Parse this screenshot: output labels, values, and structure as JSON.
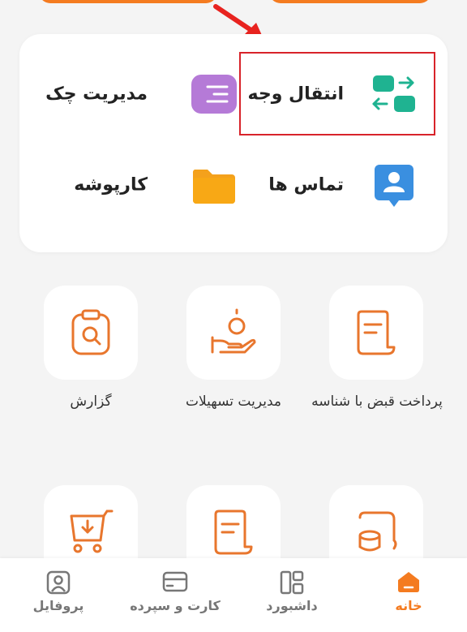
{
  "colors": {
    "accent": "#f47b20",
    "highlight": "#d8232a",
    "teal": "#1fb391",
    "purple": "#b57ad7",
    "blue": "#3a8fe0",
    "folder": "#f4a11c"
  },
  "quick_actions": [
    {
      "label": "انتقال وجه",
      "icon": "transfer-arrows-icon"
    },
    {
      "label": "مدیریت چک",
      "icon": "cheque-icon"
    },
    {
      "label": "تماس ها",
      "icon": "contacts-icon"
    },
    {
      "label": "کارپوشه",
      "icon": "folder-icon"
    }
  ],
  "services": [
    {
      "label": "پرداخت قبض با شناسه",
      "icon": "bill-icon"
    },
    {
      "label": "مدیریت تسهیلات",
      "icon": "loan-hand-icon"
    },
    {
      "label": "گزارش",
      "icon": "report-clipboard-icon"
    },
    {
      "label": "",
      "icon": "coins-icon"
    },
    {
      "label": "",
      "icon": "receipt-icon"
    },
    {
      "label": "",
      "icon": "cart-download-icon"
    }
  ],
  "nav": [
    {
      "label": "خانه",
      "icon": "home-icon",
      "active": true
    },
    {
      "label": "داشبورد",
      "icon": "dashboard-icon",
      "active": false
    },
    {
      "label": "کارت و سپرده",
      "icon": "card-icon",
      "active": false
    },
    {
      "label": "پروفایل",
      "icon": "profile-icon",
      "active": false
    }
  ]
}
